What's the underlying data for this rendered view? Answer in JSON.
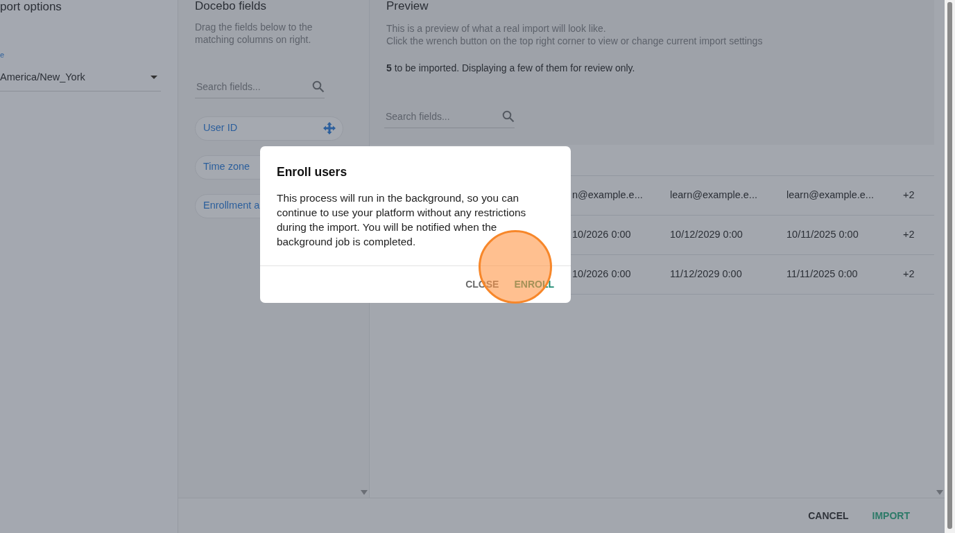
{
  "sidebar": {
    "title": "port options",
    "field_label": "e",
    "timezone_select": {
      "value": "America/New_York"
    }
  },
  "fields_panel": {
    "title": "Docebo fields",
    "description": "Drag the fields below to the matching columns on right.",
    "search": {
      "placeholder": "Search fields..."
    },
    "fields": [
      {
        "label": "User ID",
        "move_handle": true
      },
      {
        "label": "Time zone"
      },
      {
        "label": "Enrollment a"
      }
    ]
  },
  "preview": {
    "title": "Preview",
    "description_lines": [
      "This is a preview of what a real import will look like.",
      "Click the wrench button on the top right corner to view or change current import settings"
    ],
    "summary": "**5** to be imported. Displaying a few of them for review only.",
    "search": {
      "placeholder": "Search fields..."
    },
    "rows": [
      [
        "n@example.e...",
        "learn@example.e...",
        "learn@example.e...",
        "+2"
      ],
      [
        "10/2026 0:00",
        "10/12/2029 0:00",
        "10/11/2025 0:00",
        "+2"
      ],
      [
        "10/2026 0:00",
        "11/12/2029 0:00",
        "11/11/2025 0:00",
        "+2"
      ]
    ]
  },
  "footer": {
    "buttons": [
      {
        "label": "CANCEL",
        "kind": "secondary"
      },
      {
        "label": "IMPORT",
        "kind": "primary"
      }
    ]
  },
  "modal": {
    "title": "Enroll users",
    "body": "This process will run in the background, so you can continue to use your platform without any restrictions during the import. You will be notified when the background job is completed.",
    "buttons": [
      {
        "label": "CLOSE",
        "kind": "secondary"
      },
      {
        "label": "ENROLL",
        "kind": "primary"
      }
    ]
  },
  "click_marker": true
}
